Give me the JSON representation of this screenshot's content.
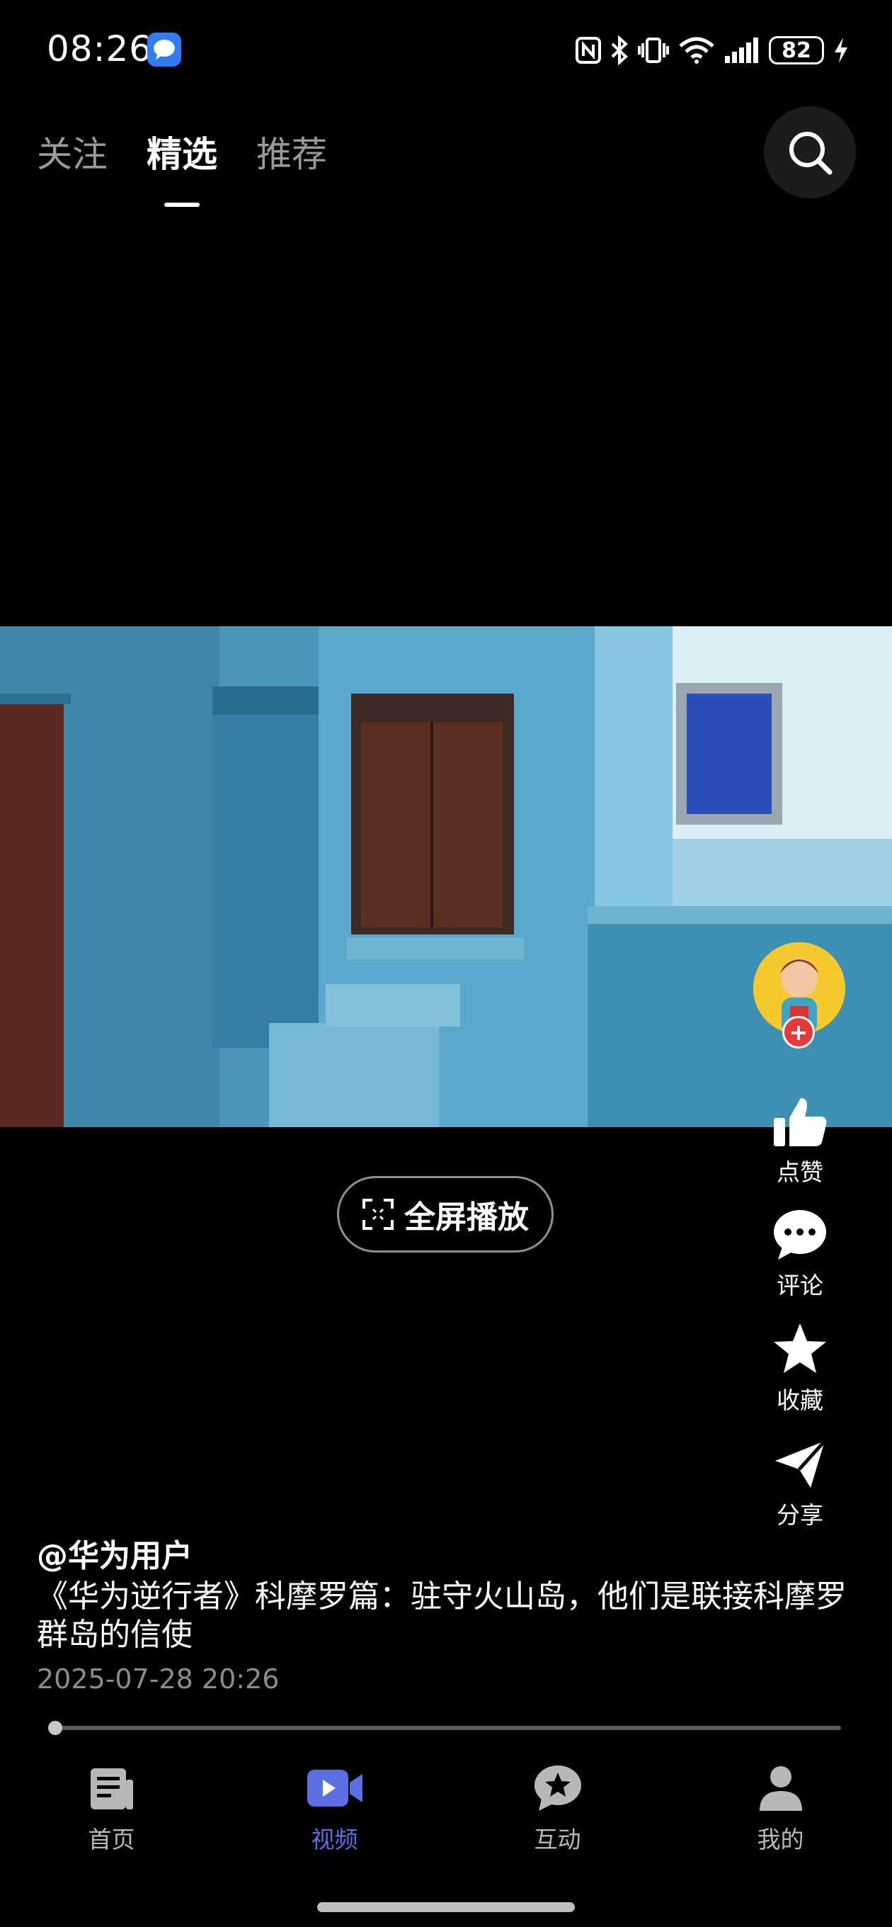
{
  "status_bar": {
    "time": "08:26",
    "battery": "82",
    "icons": [
      "message-app-icon",
      "nfc-icon",
      "bluetooth-icon",
      "vibrate-icon",
      "wifi-icon",
      "signal-icon",
      "battery-icon",
      "charging-icon"
    ]
  },
  "top_tabs": [
    {
      "label": "关注",
      "active": false
    },
    {
      "label": "精选",
      "active": true
    },
    {
      "label": "推荐",
      "active": false
    }
  ],
  "video": {
    "fullscreen_label": "全屏播放",
    "progress": 0.0
  },
  "rail": {
    "like_label": "点赞",
    "comment_label": "评论",
    "favorite_label": "收藏",
    "share_label": "分享"
  },
  "post": {
    "author": "@华为用户",
    "caption": "《华为逆行者》科摩罗篇：驻守火山岛，他们是联接科摩罗群岛的信使",
    "datetime": "2025-07-28 20:26"
  },
  "bottom_nav": [
    {
      "label": "首页",
      "icon": "news-icon",
      "active": false
    },
    {
      "label": "视频",
      "icon": "video-icon",
      "active": true
    },
    {
      "label": "互动",
      "icon": "star-chat-icon",
      "active": false
    },
    {
      "label": "我的",
      "icon": "person-icon",
      "active": false
    }
  ],
  "colors": {
    "background": "#000000",
    "accent": "#5a6fe0",
    "follow_badge": "#e8383a",
    "avatar_bg": "#f6c92f"
  }
}
